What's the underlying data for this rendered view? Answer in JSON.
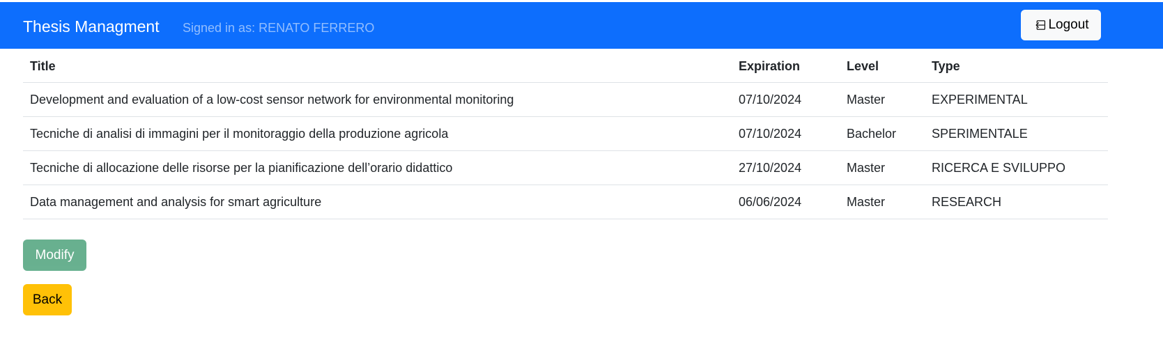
{
  "navbar": {
    "brand": "Thesis Managment",
    "signed_in": "Signed in as: RENATO FERRERO",
    "logout_label": "Logout",
    "bg_color": "#0d6efd"
  },
  "table": {
    "headers": {
      "title": "Title",
      "expiration": "Expiration",
      "level": "Level",
      "type": "Type"
    },
    "rows": [
      {
        "title": "Development and evaluation of a low-cost sensor network for environmental monitoring",
        "expiration": "07/10/2024",
        "level": "Master",
        "type": "EXPERIMENTAL"
      },
      {
        "title": "Tecniche di analisi di immagini per il monitoraggio della produzione agricola",
        "expiration": "07/10/2024",
        "level": "Bachelor",
        "type": "SPERIMENTALE"
      },
      {
        "title": "Tecniche di allocazione delle risorse per la pianificazione dell’orario didattico",
        "expiration": "27/10/2024",
        "level": "Master",
        "type": "RICERCA E SVILUPPO"
      },
      {
        "title": "Data management and analysis for smart agriculture",
        "expiration": "06/06/2024",
        "level": "Master",
        "type": "RESEARCH"
      }
    ]
  },
  "actions": {
    "modify_label": "Modify",
    "modify_state": "disabled",
    "back_label": "Back"
  },
  "icons": {
    "logout": "box-arrow-in-left-icon"
  },
  "colors": {
    "primary": "#0d6efd",
    "success": "#198754",
    "warning": "#ffc107",
    "light": "#f8f9fa"
  }
}
